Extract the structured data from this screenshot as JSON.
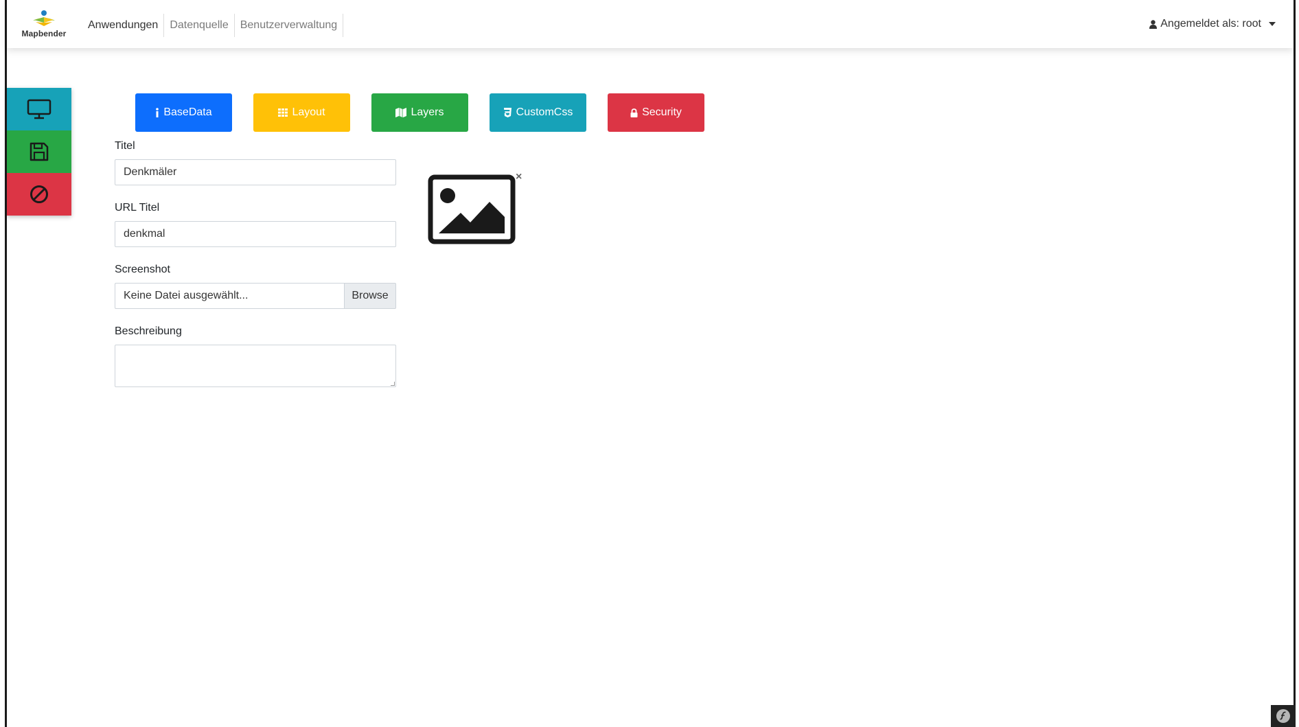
{
  "brand": {
    "name": "Mapbender"
  },
  "nav": {
    "links": [
      {
        "label": "Anwendungen"
      },
      {
        "label": "Datenquelle"
      },
      {
        "label": "Benutzerverwaltung"
      }
    ],
    "user_label": "Angemeldet als: root"
  },
  "side_actions": [
    {
      "icon": "monitor-icon",
      "color": "#17a2b8"
    },
    {
      "icon": "floppy-disk-icon",
      "color": "#28a745"
    },
    {
      "icon": "ban-icon",
      "color": "#dc3545"
    }
  ],
  "tabs": [
    {
      "label": "BaseData",
      "icon": "info-icon",
      "color": "#0d6efd"
    },
    {
      "label": "Layout",
      "icon": "grid-icon",
      "color": "#ffc107"
    },
    {
      "label": "Layers",
      "icon": "map-icon",
      "color": "#28a745"
    },
    {
      "label": "CustomCss",
      "icon": "css3-icon",
      "color": "#17a2b8"
    },
    {
      "label": "Security",
      "icon": "lock-icon",
      "color": "#dc3545"
    }
  ],
  "form": {
    "title_label": "Titel",
    "title_value": "Denkmäler",
    "url_title_label": "URL Titel",
    "url_title_value": "denkmal",
    "screenshot_label": "Screenshot",
    "screenshot_file_text": "Keine Datei ausgewählt...",
    "browse_label": "Browse",
    "description_label": "Beschreibung",
    "description_value": ""
  },
  "preview": {
    "icon": "image-placeholder-icon",
    "remove": "×"
  }
}
